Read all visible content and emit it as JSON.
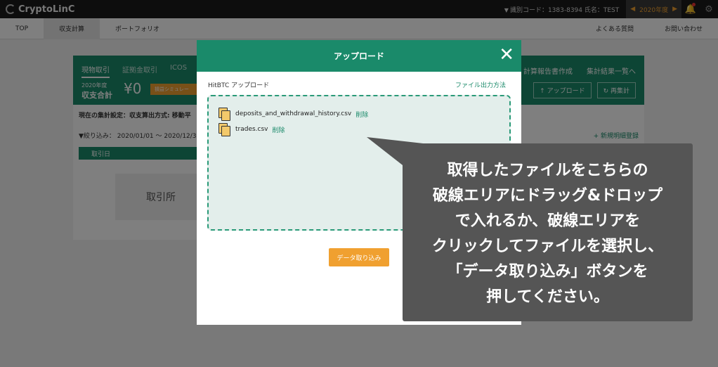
{
  "app": {
    "brand": "CryptoLinC"
  },
  "topbar": {
    "account_label": "識別コード：1383-8394  氏名：TEST",
    "year": "2020年度"
  },
  "nav": {
    "items": [
      "TOP",
      "収支計算",
      "ポートフォリオ"
    ],
    "right_items": [
      "よくある質問",
      "お問い合わせ"
    ]
  },
  "panel": {
    "subtabs": [
      "現物取引",
      "証拠金取引",
      "ICOS"
    ],
    "summary_year": "2020年度",
    "summary_label": "収支合計",
    "summary_amount": "¥0",
    "sim_button": "損益シミュレー",
    "links": [
      "計算報告書作成",
      "集計結果一覧へ"
    ],
    "buttons": [
      "アップロード",
      "再集計"
    ],
    "setting_text": "現在の集計設定：収支算出方式: 移動平",
    "filter_text": "▼絞り込み： 2020/01/01 〜 2020/12/3",
    "new_entry": "+ 新規明細登録",
    "table_header": "取引日",
    "exchange_box": "取引所"
  },
  "modal": {
    "title": "アップロード",
    "label": "HitBTC アップロード",
    "help_link": "ファイル出力方法",
    "files": [
      {
        "name": "deposits_and_withdrawal_history.csv",
        "delete": "削除"
      },
      {
        "name": "trades.csv",
        "delete": "削除"
      }
    ],
    "import_button": "データ取り込み"
  },
  "callout": {
    "lines": [
      "取得したファイルをこちらの",
      "破線エリアにドラッグ&ドロップ",
      "で入れるか、破線エリアを",
      "クリックしてファイルを選択し、",
      "「データ取り込み」ボタンを",
      "押してください。"
    ]
  },
  "colors": {
    "brand_green": "#1a8a6a",
    "accent_orange": "#f0a030",
    "callout_gray": "#555555"
  }
}
